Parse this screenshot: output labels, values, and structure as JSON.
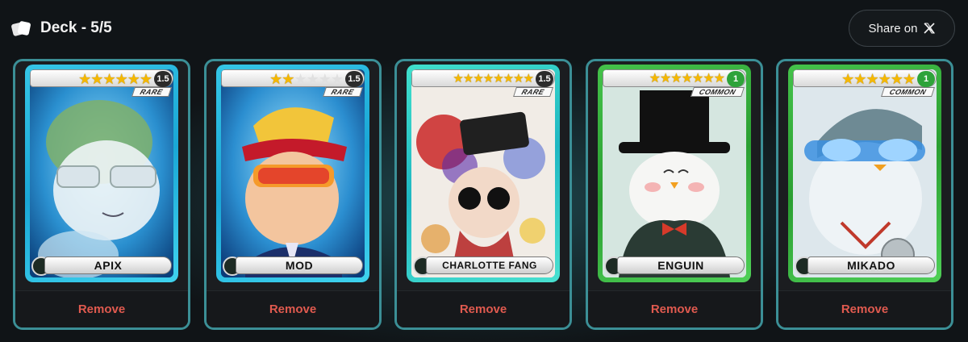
{
  "header": {
    "deck_title": "Deck - 5/5",
    "share_label": "Share on"
  },
  "cards": [
    {
      "name": "APIX",
      "stars_filled": 6,
      "stars_total": 6,
      "level": "1.5",
      "rarity": "RARE",
      "remove_label": "Remove"
    },
    {
      "name": "MOD",
      "stars_filled": 2,
      "stars_total": 6,
      "level": "1.5",
      "rarity": "RARE",
      "remove_label": "Remove"
    },
    {
      "name": "CHARLOTTE FANG",
      "stars_filled": 8,
      "stars_total": 8,
      "level": "1.5",
      "rarity": "RARE",
      "remove_label": "Remove"
    },
    {
      "name": "ENGUIN",
      "stars_filled": 7,
      "stars_total": 7,
      "level": "1",
      "rarity": "COMMON",
      "remove_label": "Remove"
    },
    {
      "name": "MIKADO",
      "stars_filled": 6,
      "stars_total": 6,
      "level": "1",
      "rarity": "COMMON",
      "remove_label": "Remove"
    }
  ],
  "colors": {
    "rare_frame": "#1aa7d6",
    "common_frame": "#2b9f32",
    "remove_text": "#e05a4f",
    "slot_border": "#3b8f96"
  },
  "icons": {
    "deck": "cards-stack-icon",
    "share": "x-logo-icon",
    "element": "element-orb-icon"
  }
}
